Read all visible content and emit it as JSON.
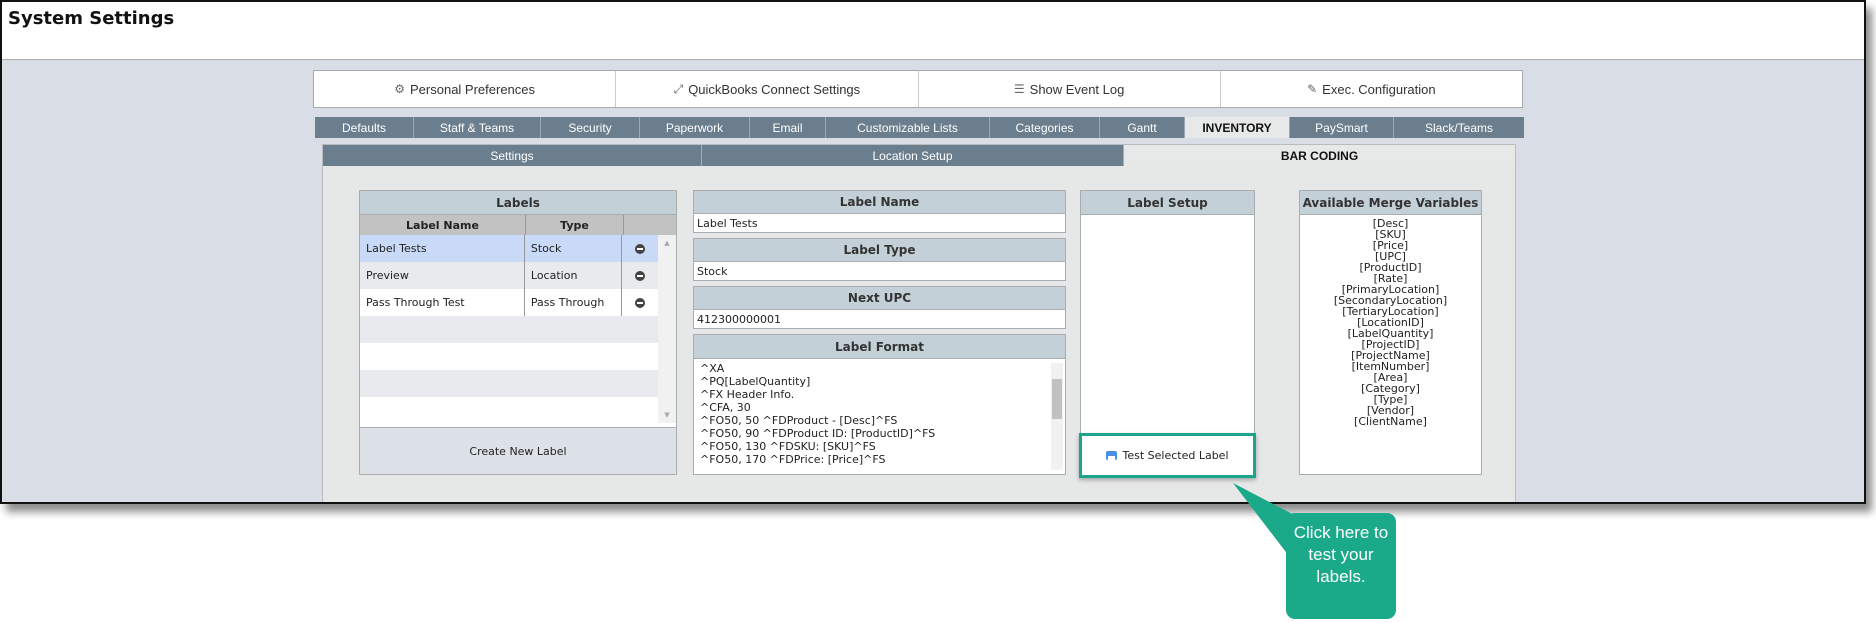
{
  "window": {
    "title": "System Settings"
  },
  "top_buttons": [
    {
      "label": "Personal Preferences",
      "icon": "gear-icon"
    },
    {
      "label": "QuickBooks Connect Settings",
      "icon": "expand-arrows-icon"
    },
    {
      "label": "Show Event Log",
      "icon": "list-icon"
    },
    {
      "label": "Exec. Configuration",
      "icon": "edit-icon"
    }
  ],
  "tabs": [
    {
      "label": "Defaults"
    },
    {
      "label": "Staff & Teams"
    },
    {
      "label": "Security"
    },
    {
      "label": "Paperwork"
    },
    {
      "label": "Email"
    },
    {
      "label": "Customizable Lists"
    },
    {
      "label": "Categories"
    },
    {
      "label": "Gantt"
    },
    {
      "label": "INVENTORY",
      "active": true
    },
    {
      "label": "PaySmart"
    },
    {
      "label": "Slack/Teams"
    }
  ],
  "subtabs": [
    {
      "label": "Settings"
    },
    {
      "label": "Location Setup"
    },
    {
      "label": "BAR CODING",
      "active": true
    }
  ],
  "labels_panel": {
    "title": "Labels",
    "columns": [
      "Label Name",
      "Type"
    ],
    "rows": [
      {
        "name": "Label Tests",
        "type": "Stock",
        "selected": true
      },
      {
        "name": "Preview",
        "type": "Location"
      },
      {
        "name": "Pass Through Test",
        "type": "Pass Through"
      }
    ],
    "create_label": "Create New Label"
  },
  "label_name": {
    "title": "Label Name",
    "value": "Label Tests"
  },
  "label_type": {
    "title": "Label Type",
    "value": "Stock"
  },
  "next_upc": {
    "title": "Next UPC",
    "value": "412300000001"
  },
  "label_format": {
    "title": "Label Format",
    "value": "^XA\n^PQ[LabelQuantity]\n^FX Header Info.\n^CFA, 30\n^FO50, 50 ^FDProduct - [Desc]^FS\n^FO50, 90 ^FDProduct ID: [ProductID]^FS\n^FO50, 130 ^FDSKU: [SKU]^FS\n^FO50, 170 ^FDPrice: [Price]^FS"
  },
  "label_setup": {
    "title": "Label Setup",
    "test_button": "Test Selected Label"
  },
  "merge_variables": {
    "title": "Available Merge Variables",
    "items": [
      "[Desc]",
      "[SKU]",
      "[Price]",
      "[UPC]",
      "[ProductID]",
      "[Rate]",
      "[PrimaryLocation]",
      "[SecondaryLocation]",
      "[TertiaryLocation]",
      "[LocationID]",
      "[LabelQuantity]",
      "[ProjectID]",
      "[ProjectName]",
      "[ItemNumber]",
      "[Area]",
      "[Category]",
      "[Type]",
      "[Vendor]",
      "[ClientName]"
    ]
  },
  "callout": {
    "text": "Click here to test your labels.",
    "color": "#1aaa8a"
  },
  "colors": {
    "tab_bg": "#6b7e8e",
    "panel_header": "#c4d0d8",
    "selected_row": "#c9daf8",
    "highlight": "#1aa58a"
  }
}
